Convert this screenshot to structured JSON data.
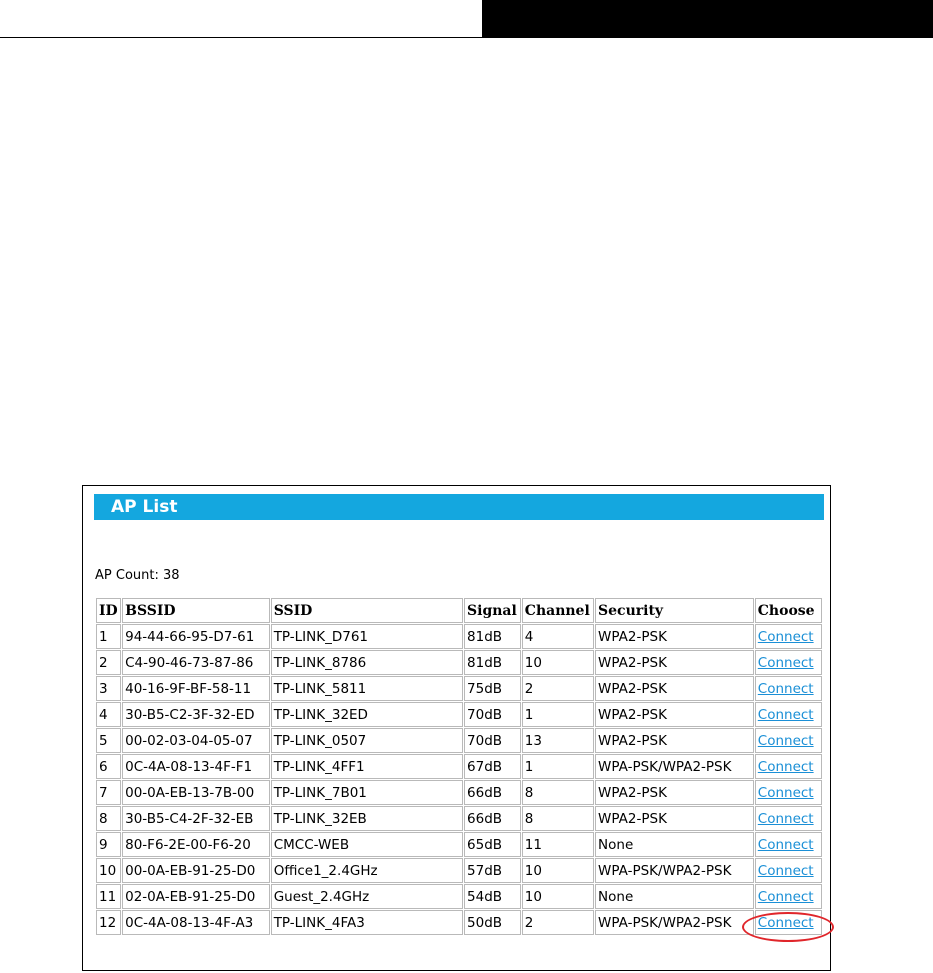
{
  "panel": {
    "title": "AP List",
    "ap_count": "AP Count: 38"
  },
  "table": {
    "headers": [
      "ID",
      "BSSID",
      "SSID",
      "Signal",
      "Channel",
      "Security",
      "Choose"
    ],
    "rows": [
      {
        "id": "1",
        "bssid": "94-44-66-95-D7-61",
        "ssid": "TP-LINK_D761",
        "signal": "81dB",
        "channel": "4",
        "security": "WPA2-PSK",
        "choose": "Connect"
      },
      {
        "id": "2",
        "bssid": "C4-90-46-73-87-86",
        "ssid": "TP-LINK_8786",
        "signal": "81dB",
        "channel": "10",
        "security": "WPA2-PSK",
        "choose": "Connect"
      },
      {
        "id": "3",
        "bssid": "40-16-9F-BF-58-11",
        "ssid": "TP-LINK_5811",
        "signal": "75dB",
        "channel": "2",
        "security": "WPA2-PSK",
        "choose": "Connect"
      },
      {
        "id": "4",
        "bssid": "30-B5-C2-3F-32-ED",
        "ssid": "TP-LINK_32ED",
        "signal": "70dB",
        "channel": "1",
        "security": "WPA2-PSK",
        "choose": "Connect"
      },
      {
        "id": "5",
        "bssid": "00-02-03-04-05-07",
        "ssid": "TP-LINK_0507",
        "signal": "70dB",
        "channel": "13",
        "security": "WPA2-PSK",
        "choose": "Connect"
      },
      {
        "id": "6",
        "bssid": "0C-4A-08-13-4F-F1",
        "ssid": "TP-LINK_4FF1",
        "signal": "67dB",
        "channel": "1",
        "security": "WPA-PSK/WPA2-PSK",
        "choose": "Connect"
      },
      {
        "id": "7",
        "bssid": "00-0A-EB-13-7B-00",
        "ssid": "TP-LINK_7B01",
        "signal": "66dB",
        "channel": "8",
        "security": "WPA2-PSK",
        "choose": "Connect"
      },
      {
        "id": "8",
        "bssid": "30-B5-C4-2F-32-EB",
        "ssid": "TP-LINK_32EB",
        "signal": "66dB",
        "channel": "8",
        "security": "WPA2-PSK",
        "choose": "Connect"
      },
      {
        "id": "9",
        "bssid": "80-F6-2E-00-F6-20",
        "ssid": "CMCC-WEB",
        "signal": "65dB",
        "channel": "11",
        "security": "None",
        "choose": "Connect"
      },
      {
        "id": "10",
        "bssid": "00-0A-EB-91-25-D0",
        "ssid": "Office1_2.4GHz",
        "signal": "57dB",
        "channel": "10",
        "security": "WPA-PSK/WPA2-PSK",
        "choose": "Connect"
      },
      {
        "id": "11",
        "bssid": "02-0A-EB-91-25-D0",
        "ssid": "Guest_2.4GHz",
        "signal": "54dB",
        "channel": "10",
        "security": "None",
        "choose": "Connect"
      },
      {
        "id": "12",
        "bssid": "0C-4A-08-13-4F-A3",
        "ssid": "TP-LINK_4FA3",
        "signal": "50dB",
        "channel": "2",
        "security": "WPA-PSK/WPA2-PSK",
        "choose": "Connect"
      }
    ]
  },
  "colors": {
    "header_bg": "#14a7df",
    "link": "#1a8fd6",
    "highlight": "#e0262b",
    "cell_border": "#b9b9b9"
  }
}
